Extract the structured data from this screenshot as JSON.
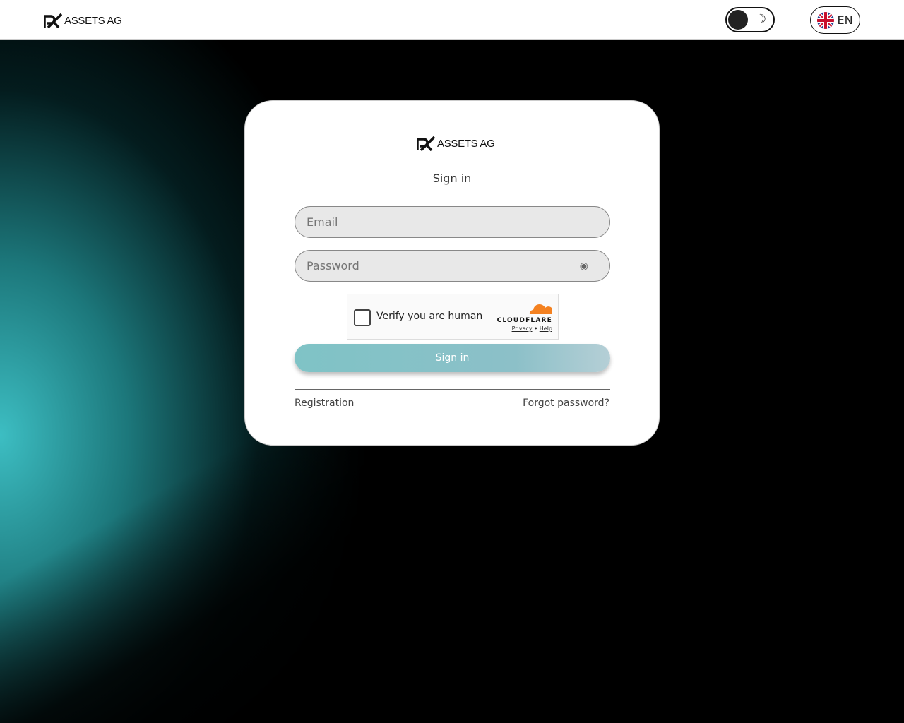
{
  "header": {
    "logo_text": "ASSETS AG",
    "theme_toggle": "dark-mode",
    "language": "EN"
  },
  "card": {
    "logo_text": "ASSETS AG",
    "title": "Sign in",
    "email_placeholder": "Email",
    "password_placeholder": "Password",
    "captcha": {
      "label": "Verify you are human",
      "brand": "CLOUDFLARE",
      "privacy": "Privacy",
      "separator": "•",
      "help": "Help"
    },
    "signin_label": "Sign in",
    "registration": "Registration",
    "forgot": "Forgot password?"
  }
}
